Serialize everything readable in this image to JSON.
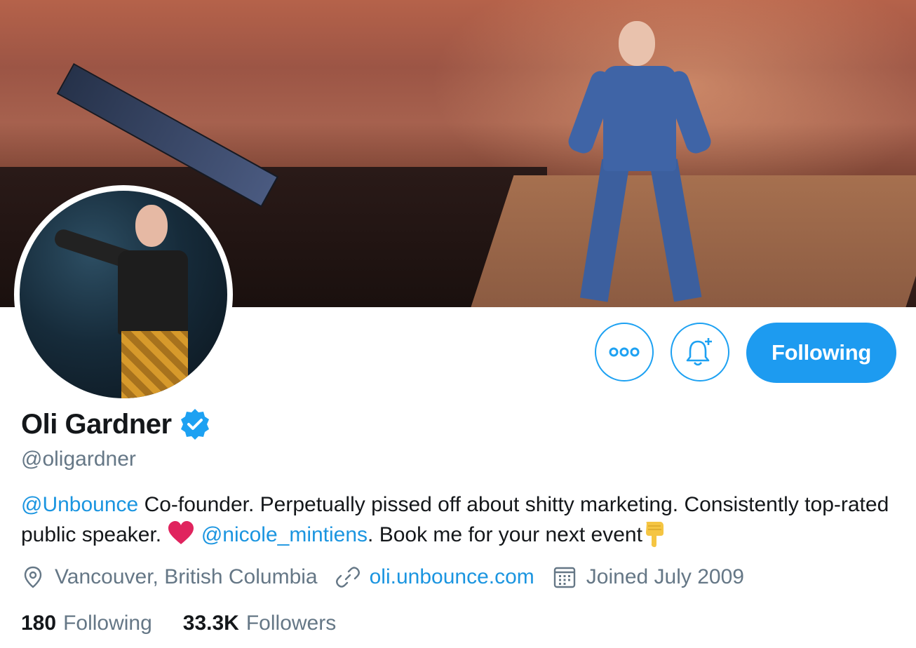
{
  "profile": {
    "name": "Oli Gardner",
    "handle": "@oligardner",
    "verified": true,
    "bio": {
      "mention_1": "@Unbounce",
      "text_1": " Co-founder. Perpetually pissed off about shitty marketing. Consistently top-rated public speaker. ",
      "heart_icon": "red-heart-emoji",
      "mention_2": "@nicole_mintiens",
      "text_2": ". Book me for your next event",
      "end_icon": "backhand-index-pointing-down-emoji"
    },
    "location": "Vancouver, British Columbia",
    "website": "oli.unbounce.com",
    "joined": "Joined July 2009",
    "stats": {
      "following_count": "180",
      "following_label": "Following",
      "followers_count": "33.3K",
      "followers_label": "Followers"
    }
  },
  "actions": {
    "more_icon": "ellipsis-icon",
    "notify_icon": "bell-plus-icon",
    "follow_button_label": "Following"
  },
  "colors": {
    "accent": "#1da1f2",
    "text_primary": "#14171a",
    "text_secondary": "#657786",
    "link": "#1b95e0"
  }
}
